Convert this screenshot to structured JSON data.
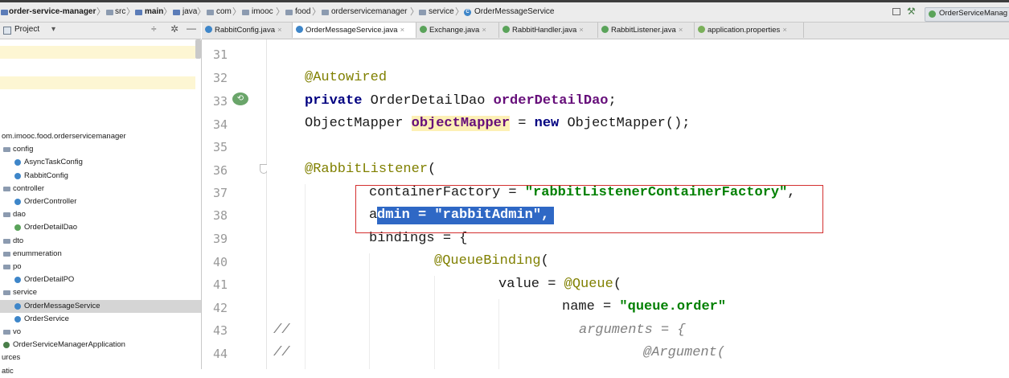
{
  "breadcrumbs": [
    {
      "label": "order-service-manager",
      "bold": true
    },
    {
      "label": "src",
      "bold": false
    },
    {
      "label": "main",
      "bold": true
    },
    {
      "label": "java",
      "bold": false
    },
    {
      "label": "com",
      "bold": false
    },
    {
      "label": "imooc",
      "bold": false
    },
    {
      "label": "food",
      "bold": false
    },
    {
      "label": "orderservicemanager",
      "bold": false
    },
    {
      "label": "service",
      "bold": false
    },
    {
      "label": "OrderMessageService",
      "bold": false
    }
  ],
  "run_config": "OrderServiceManag",
  "project_panel": {
    "label": "Project",
    "dropdown": "▾"
  },
  "tabs": [
    {
      "label": "RabbitConfig.java",
      "active": false,
      "color": "#3e86c9"
    },
    {
      "label": "OrderMessageService.java",
      "active": true,
      "color": "#3e86c9"
    },
    {
      "label": "Exchange.java",
      "active": false,
      "color": "#5aa35a"
    },
    {
      "label": "RabbitHandler.java",
      "active": false,
      "color": "#5aa35a"
    },
    {
      "label": "RabbitListener.java",
      "active": false,
      "color": "#5aa35a"
    },
    {
      "label": "application.properties",
      "active": false,
      "color": "#7ab05a"
    }
  ],
  "tab_close": "×",
  "tree": [
    {
      "label": "om.imooc.food.orderservicemanager",
      "icon": "none",
      "indent": 0
    },
    {
      "label": "config",
      "icon": "folder",
      "indent": 1
    },
    {
      "label": "AsyncTaskConfig",
      "icon": "cls",
      "indent": 2
    },
    {
      "label": "RabbitConfig",
      "icon": "cls",
      "indent": 2
    },
    {
      "label": "controller",
      "icon": "folder",
      "indent": 1
    },
    {
      "label": "OrderController",
      "icon": "cls",
      "indent": 2
    },
    {
      "label": "dao",
      "icon": "folder",
      "indent": 1
    },
    {
      "label": "OrderDetailDao",
      "icon": "iface",
      "indent": 2
    },
    {
      "label": "dto",
      "icon": "folder",
      "indent": 1
    },
    {
      "label": "enummeration",
      "icon": "folder",
      "indent": 1
    },
    {
      "label": "po",
      "icon": "folder",
      "indent": 1
    },
    {
      "label": "OrderDetailPO",
      "icon": "cls",
      "indent": 2
    },
    {
      "label": "service",
      "icon": "folder",
      "indent": 1
    },
    {
      "label": "OrderMessageService",
      "icon": "cls",
      "indent": 2,
      "selected": true
    },
    {
      "label": "OrderService",
      "icon": "cls",
      "indent": 2
    },
    {
      "label": "vo",
      "icon": "folder",
      "indent": 1
    },
    {
      "label": "OrderServiceManagerApplication",
      "icon": "app",
      "indent": 1
    },
    {
      "label": "urces",
      "icon": "none",
      "indent": 0
    },
    {
      "label": "atic",
      "icon": "none",
      "indent": 0
    }
  ],
  "line_numbers": [
    "31",
    "32",
    "33",
    "34",
    "35",
    "36",
    "37",
    "38",
    "39",
    "40",
    "41",
    "42",
    "43",
    "44"
  ],
  "code": {
    "l32_ann": "@Autowired",
    "l33_kw": "private",
    "l33_type": " OrderDetailDao ",
    "l33_fld": "orderDetailDao",
    "l33_end": ";",
    "l34_type": "ObjectMapper ",
    "l34_fld": "objectMapper",
    "l34_eq": " = ",
    "l34_kw": "new",
    "l34_end": " ObjectMapper();",
    "l36_ann": "@RabbitListener",
    "l36_paren": "(",
    "l37_key": "containerFactory = ",
    "l37_str": "\"rabbitListenerContainerFactory\"",
    "l37_end": ",",
    "l38_a": "a",
    "l38_sel": "dmin = \"rabbitAdmin\",",
    "l39": "bindings = {",
    "l40_ann": "@QueueBinding",
    "l40_paren": "(",
    "l41_key": "value = ",
    "l41_ann": "@Queue",
    "l41_paren": "(",
    "l42_key": "name = ",
    "l42_str": "\"queue.order\"",
    "l43_slash": "//",
    "l43_txt": "arguments = {",
    "l44_slash": "//",
    "l44_txt": "@Argument("
  }
}
